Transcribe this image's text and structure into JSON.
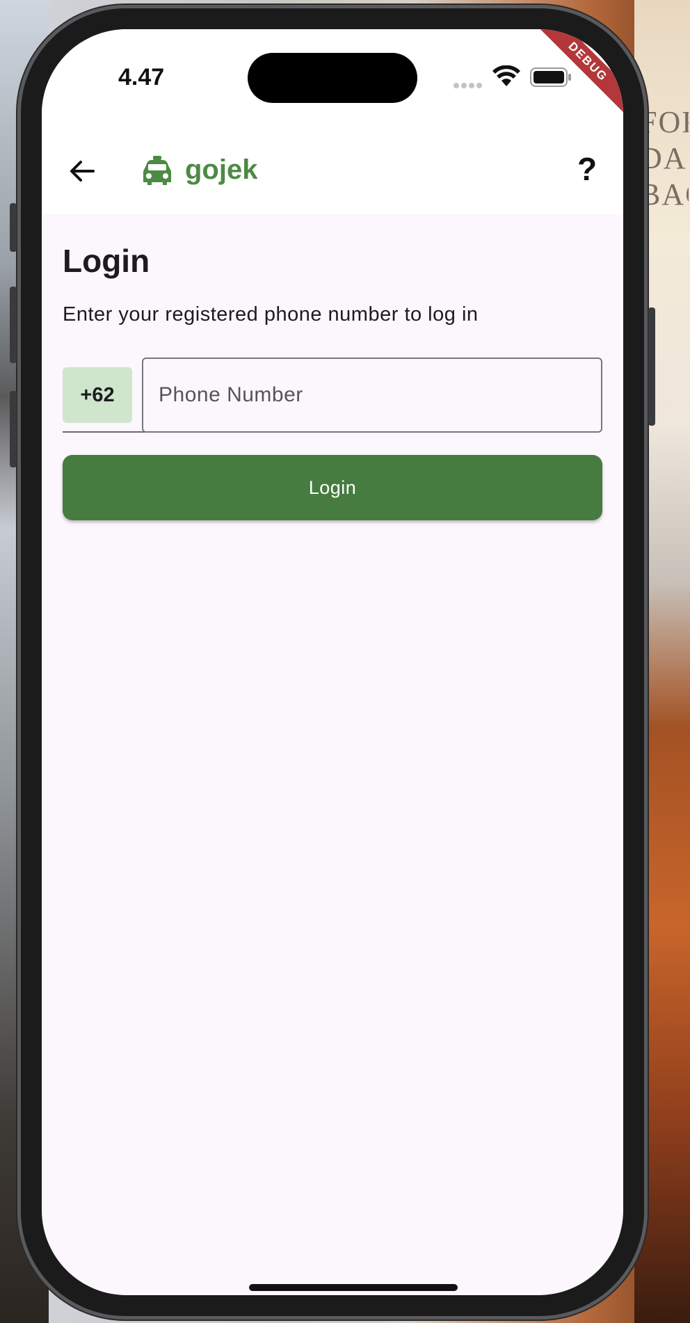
{
  "status_bar": {
    "time": "4.47"
  },
  "debug_banner": "DEBUG",
  "app_bar": {
    "brand": "gojek",
    "help_label": "?",
    "icons": [
      "back-arrow-icon",
      "car-icon",
      "help-icon"
    ]
  },
  "login_form": {
    "title": "Login",
    "subtitle": "Enter your registered phone number to log in",
    "country_code": "+62",
    "phone_placeholder": "Phone Number",
    "phone_value": "",
    "login_button_label": "Login"
  },
  "colors": {
    "brand_green": "#4d8a45",
    "button_green": "#477c40",
    "code_chip_bg": "#cfe6cc",
    "screen_bg": "#fcf7fc",
    "debug_red": "#b2383b"
  }
}
